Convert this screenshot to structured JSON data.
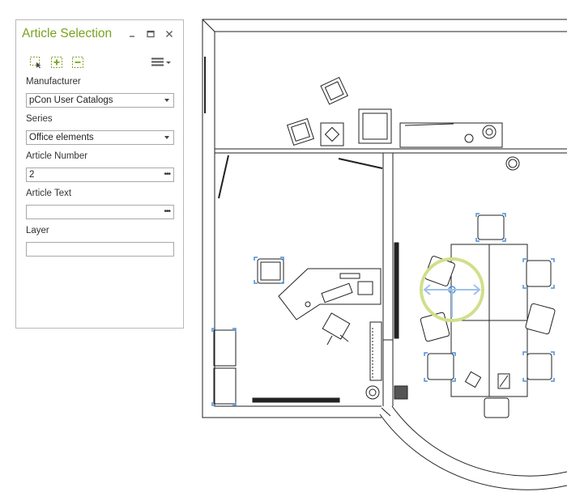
{
  "panel": {
    "title": "Article Selection",
    "controls": {
      "minimize_icon": "minimize-icon",
      "maximize_icon": "maximize-icon",
      "close_icon": "close-icon"
    },
    "toolbar": [
      "select-area-icon",
      "add-icon",
      "remove-icon",
      "menu-icon"
    ],
    "fields": {
      "manufacturer": {
        "label": "Manufacturer",
        "value": "pCon User Catalogs"
      },
      "series": {
        "label": "Series",
        "value": "Office elements"
      },
      "article_number": {
        "label": "Article Number",
        "value": "2"
      },
      "article_text": {
        "label": "Article Text",
        "value": ""
      },
      "layer": {
        "label": "Layer",
        "value": ""
      }
    }
  },
  "colors": {
    "accent": "#7aa21f",
    "selection": "#4f8fd6",
    "gizmo": "#cfe08a"
  }
}
